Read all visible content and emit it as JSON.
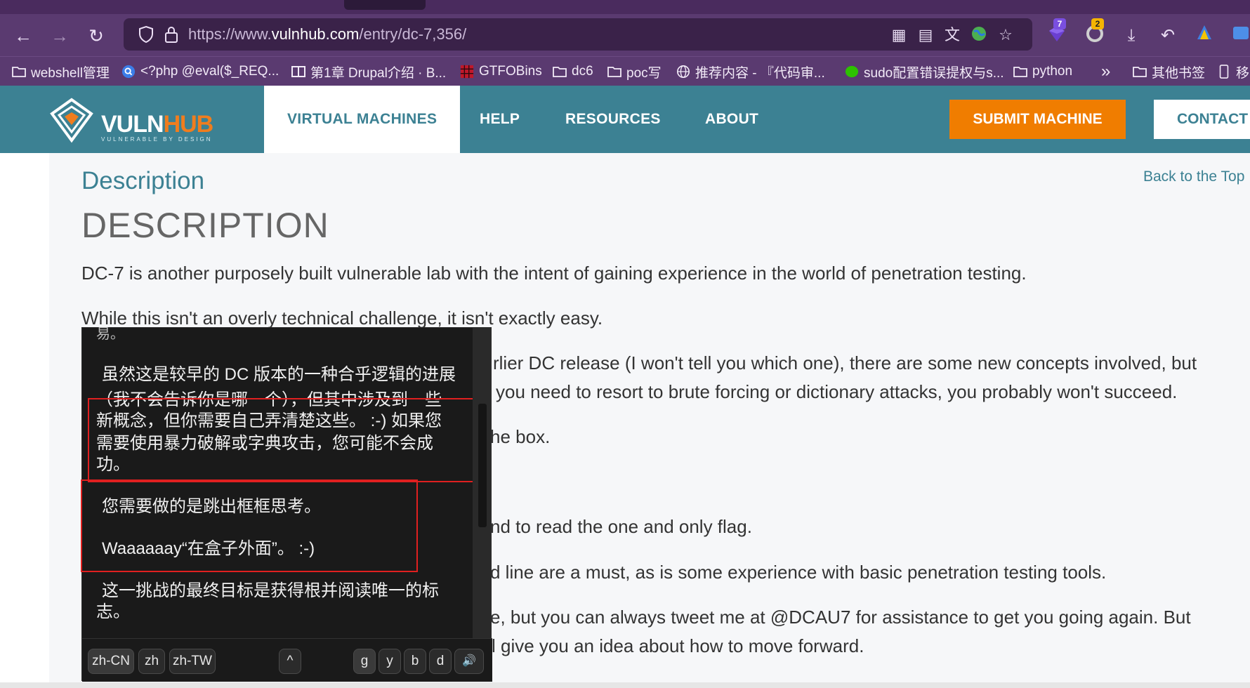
{
  "browser": {
    "url_prefix": "https://www.",
    "url_domain": "vulnhub.com",
    "url_path": "/entry/dc-7,356/",
    "nav": {
      "back": "←",
      "forward": "→",
      "reload": "↻"
    },
    "badges": {
      "ext1": "7",
      "ext2": "2"
    },
    "bookmarks": [
      {
        "label": "webshell管理",
        "icon": "folder-icon"
      },
      {
        "label": "<?php @eval($_REQ...",
        "icon": "search-icon"
      },
      {
        "label": "第1章 Drupal介绍 · B...",
        "icon": "book-icon"
      },
      {
        "label": "GTFOBins",
        "icon": "grid-icon"
      },
      {
        "label": "dc6",
        "icon": "folder-icon"
      },
      {
        "label": "poc写",
        "icon": "folder-icon"
      },
      {
        "label": "推荐内容 - 『代码审...",
        "icon": "globe-icon"
      },
      {
        "label": "sudo配置错误提权与s...",
        "icon": "wechat-icon"
      },
      {
        "label": "python",
        "icon": "folder-icon"
      },
      {
        "label": "»",
        "icon": ""
      },
      {
        "label": "其他书签",
        "icon": "folder-icon"
      },
      {
        "label": "移动",
        "icon": "mobile-icon"
      }
    ]
  },
  "site": {
    "logo_main": "VULN",
    "logo_accent": "HUB",
    "logo_tagline": "VULNERABLE BY DESIGN",
    "nav": [
      "VIRTUAL MACHINES",
      "HELP",
      "RESOURCES",
      "ABOUT"
    ],
    "submit": "SUBMIT MACHINE",
    "contact": "CONTACT"
  },
  "content": {
    "section_title": "Description",
    "back_to_top": "Back to the Top",
    "heading": "DESCRIPTION",
    "p1": "DC-7 is another purposely built vulnerable lab with the intent of gaining experience in the world of penetration testing.",
    "p2": "While this isn't an overly technical challenge, it isn't exactly easy.",
    "p3a": "rlier DC release (I won't tell you which one), there are some new concepts involved, but",
    "p3b": "you need to resort to brute forcing or dictionary attacks, you probably won't succeed.",
    "p4": "he box.",
    "p5": "nd to read the one and only flag.",
    "p6": "d line are a must, as is some experience with basic penetration testing tools.",
    "p7a": "e, but you can always tweet me at @DCAU7 for assistance to get you going again. But",
    "p7b": "l give you an idea about how to move forward."
  },
  "translation_popup": {
    "top_cut": "易。",
    "l1": "虽然这是较早的 DC 版本的一种合乎逻辑的进展",
    "l2": "（我不会告诉你是哪一个），但其中涉及到一些",
    "l3": "新概念，但你需要自己弄清楚这些。  :-) 如果您",
    "l4": "需要使用暴力破解或字典攻击，您可能不会成",
    "l5": "功。",
    "l6": "您需要做的是跳出框框思考。",
    "l7": "Waaaaaay“在盒子外面”。  :-)",
    "l8": "这一挑战的最终目标是获得根并阅读唯一的标",
    "l9": "志。",
    "langs": [
      "zh-CN",
      "zh",
      "zh-TW"
    ],
    "collapse": "^",
    "engines": [
      "g",
      "y",
      "b",
      "d"
    ],
    "speaker": "🔊"
  }
}
